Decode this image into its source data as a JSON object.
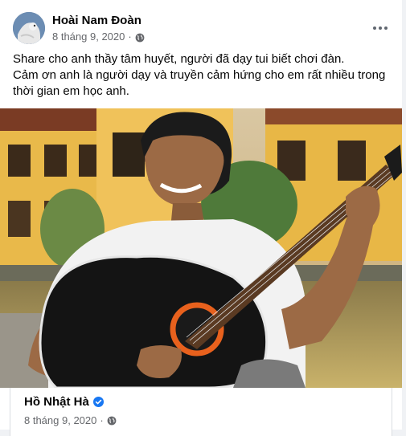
{
  "post": {
    "author": "Hoài Nam Đoàn",
    "date": "8 tháng 9, 2020",
    "separator": "·",
    "text_line1": "Share cho anh thầy tâm huyết, người đã dạy tui biết chơi đàn.",
    "text_line2": "Cảm ơn anh là người dạy và truyền cảm hứng cho em rất nhiều trong thời gian em học anh.",
    "more_icon": "more-horizontal-icon",
    "privacy_icon": "globe-icon"
  },
  "shared_post": {
    "author": "Hồ Nhật Hà",
    "date": "8 tháng 9, 2020",
    "separator": "·",
    "verified_icon": "verified-badge-icon",
    "privacy_icon": "globe-icon"
  },
  "colors": {
    "text_primary": "#050505",
    "text_secondary": "#65676b",
    "verified_blue": "#1877f2",
    "card_bg": "#ffffff"
  }
}
